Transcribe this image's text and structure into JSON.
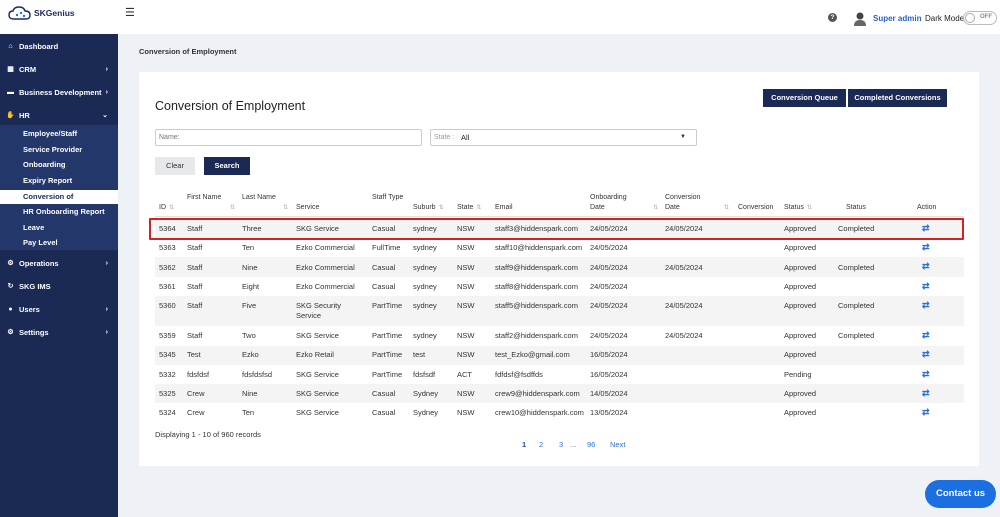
{
  "app": {
    "logo_text": "SKGenius"
  },
  "topbar": {
    "help_icon": "question-icon",
    "user_name": "Super admin",
    "dark_mode_label": "Dark Mode",
    "toggle_state": "OFF"
  },
  "sidebar": {
    "items": [
      {
        "label": "Dashboard",
        "icon": "home-icon",
        "glyph": "⌂"
      },
      {
        "label": "CRM",
        "icon": "grid-icon",
        "glyph": "▦"
      },
      {
        "label": "Business Development",
        "icon": "briefcase-icon",
        "glyph": "▬"
      },
      {
        "label": "HR",
        "icon": "handshake-icon",
        "glyph": "✋"
      },
      {
        "label": "Operations",
        "icon": "cog-icon",
        "glyph": "⚙"
      },
      {
        "label": "SKG IMS",
        "icon": "refresh-icon",
        "glyph": "↻"
      },
      {
        "label": "Users",
        "icon": "users-icon",
        "glyph": "👥"
      },
      {
        "label": "Settings",
        "icon": "settings-icon",
        "glyph": "⚙"
      }
    ],
    "hr_sub_items": [
      "Employee/Staff",
      "Service Provider",
      "Onboarding",
      "Expiry Report",
      "Conversion of Employment",
      "HR Onboarding Report",
      "Leave",
      "Pay Level"
    ]
  },
  "breadcrumb": "Conversion of Employment",
  "page_title": "Conversion of Employment",
  "buttons": {
    "conversion_queue": "Conversion Queue",
    "completed_conversions": "Completed Conversions",
    "clear": "Clear",
    "search": "Search"
  },
  "filters": {
    "name_placeholder": "Name:",
    "state_label": "State :",
    "state_value": "All"
  },
  "table": {
    "headers": [
      "ID",
      "First Name",
      "Last Name",
      "Service",
      "Staff Type",
      "Suburb",
      "State",
      "Email",
      "Onboarding Date",
      "Conversion Date",
      "Conversion",
      "Status",
      "Status",
      "Action"
    ],
    "rows": [
      [
        "5364",
        "Staff",
        "Three",
        "SKG Service",
        "Casual",
        "sydney",
        "NSW",
        "staff3@hiddenspark.com",
        "24/05/2024",
        "24/05/2024",
        "",
        "Approved",
        "Completed"
      ],
      [
        "5363",
        "Staff",
        "Ten",
        "Ezko Commercial",
        "FullTime",
        "sydney",
        "NSW",
        "staff10@hiddenspark.com",
        "24/05/2024",
        "",
        "",
        "Approved",
        ""
      ],
      [
        "5362",
        "Staff",
        "Nine",
        "Ezko Commercial",
        "Casual",
        "sydney",
        "NSW",
        "staff9@hiddenspark.com",
        "24/05/2024",
        "24/05/2024",
        "",
        "Approved",
        "Completed"
      ],
      [
        "5361",
        "Staff",
        "Eight",
        "Ezko Commercial",
        "Casual",
        "sydney",
        "NSW",
        "staff8@hiddenspark.com",
        "24/05/2024",
        "",
        "",
        "Approved",
        ""
      ],
      [
        "5360",
        "Staff",
        "Five",
        "SKG Security Service",
        "PartTime",
        "sydney",
        "NSW",
        "staff5@hiddenspark.com",
        "24/05/2024",
        "24/05/2024",
        "",
        "Approved",
        "Completed"
      ],
      [
        "5359",
        "Staff",
        "Two",
        "SKG Service",
        "PartTime",
        "sydney",
        "NSW",
        "staff2@hiddenspark.com",
        "24/05/2024",
        "24/05/2024",
        "",
        "Approved",
        "Completed"
      ],
      [
        "5345",
        "Test",
        "Ezko",
        "Ezko Retail",
        "PartTime",
        "test",
        "NSW",
        "test_Ezko@gmail.com",
        "16/05/2024",
        "",
        "",
        "Approved",
        ""
      ],
      [
        "5332",
        "fdsfdsf",
        "fdsfdsfsd",
        "SKG Service",
        "PartTime",
        "fdsfsdf",
        "ACT",
        "fdfdsf@fsdffds",
        "16/05/2024",
        "",
        "",
        "Pending",
        ""
      ],
      [
        "5325",
        "Crew",
        "Nine",
        "SKG Service",
        "Casual",
        "Sydney",
        "NSW",
        "crew9@hiddenspark.com",
        "14/05/2024",
        "",
        "",
        "Approved",
        ""
      ],
      [
        "5324",
        "Crew",
        "Ten",
        "SKG Service",
        "Casual",
        "Sydney",
        "NSW",
        "crew10@hiddenspark.com",
        "13/05/2024",
        "",
        "",
        "Approved",
        ""
      ]
    ],
    "action_icon": "swap-arrows-icon",
    "displaying": "Displaying 1 - 10 of 960 records"
  },
  "pagination": {
    "pages": [
      "1",
      "2",
      "3",
      "...",
      "96",
      "Next"
    ],
    "current": "1"
  },
  "contact_button": "Contact us"
}
